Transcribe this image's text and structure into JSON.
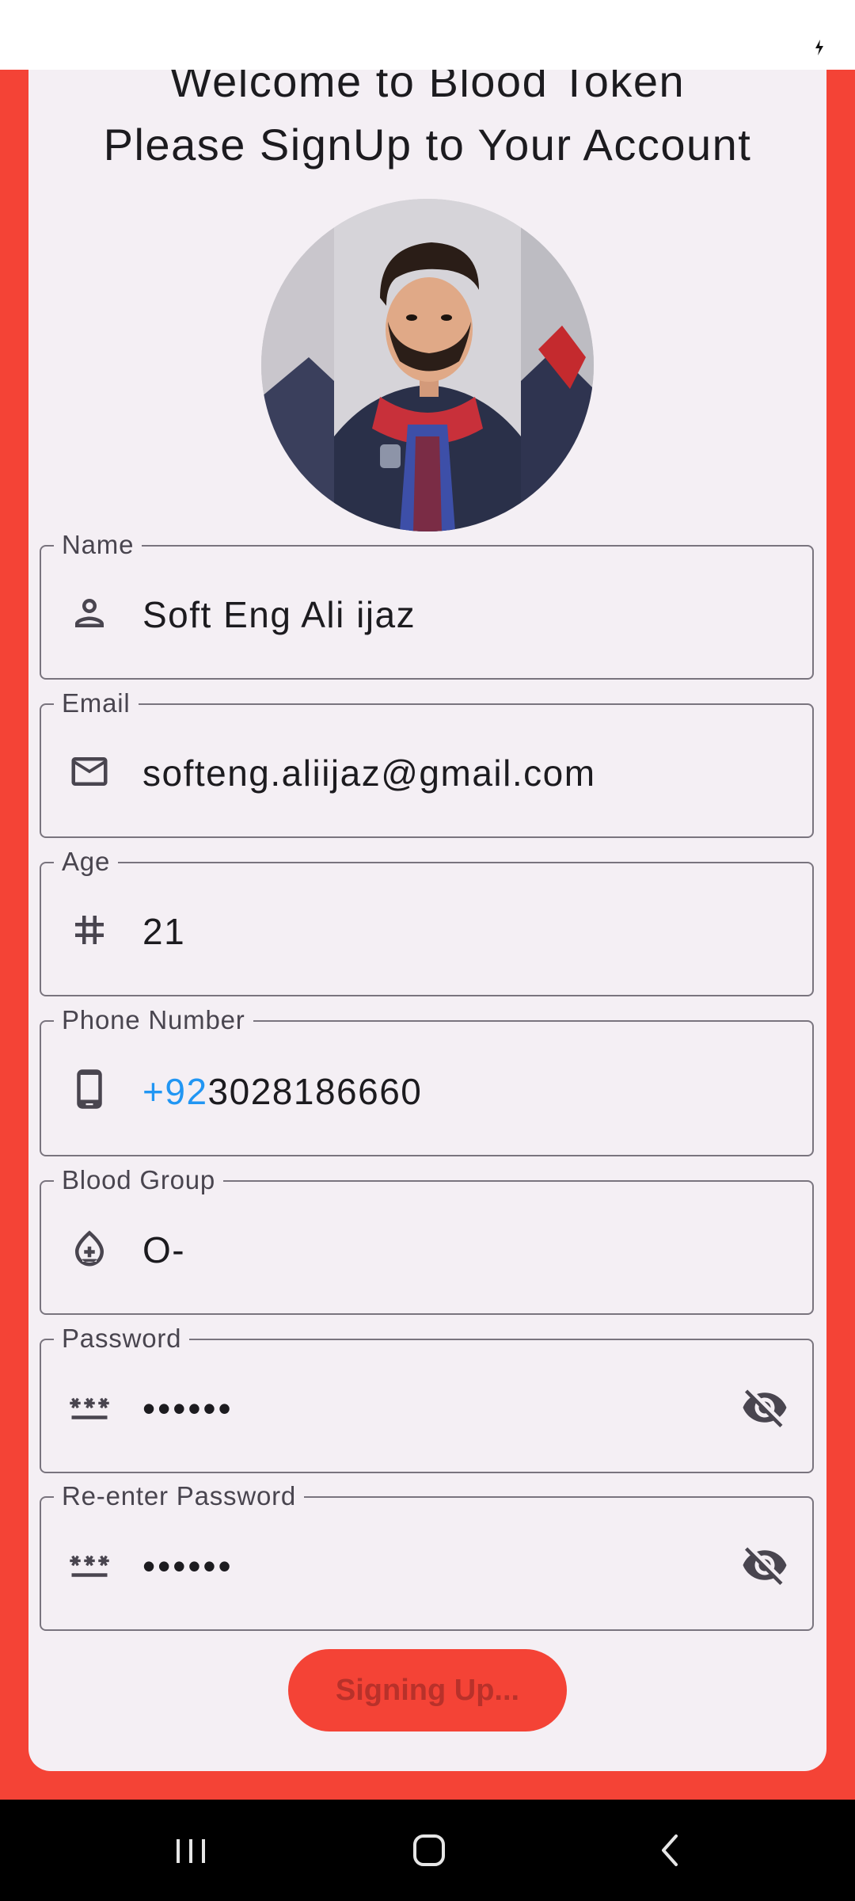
{
  "welcome": {
    "line1": "Welcome to Blood Token",
    "line2": "Please SignUp to Your Account"
  },
  "form": {
    "name": {
      "label": "Name",
      "value": "Soft Eng Ali ijaz",
      "icon": "person-icon"
    },
    "email": {
      "label": "Email",
      "value": "softeng.aliijaz@gmail.com",
      "icon": "mail-icon"
    },
    "age": {
      "label": "Age",
      "value": "21",
      "icon": "hash-icon"
    },
    "phone": {
      "label": "Phone Number",
      "country_code": "+92",
      "number": "3028186660",
      "icon": "phone-icon"
    },
    "blood_group": {
      "label": "Blood Group",
      "value": "O-",
      "icon": "blood-drop-icon"
    },
    "password": {
      "label": "Password",
      "value": "••••••",
      "icon": "password-icon",
      "toggle_icon": "visibility-off-icon"
    },
    "reenter_password": {
      "label": "Re-enter Password",
      "value": "••••••",
      "icon": "password-icon",
      "toggle_icon": "visibility-off-icon"
    }
  },
  "button": {
    "label": "Signing Up..."
  },
  "colors": {
    "primary": "#F44336",
    "surface": "#F4EFF4",
    "country_code": "#2196F3",
    "outline": "#79747E"
  },
  "nav": {
    "icons": [
      "recents-icon",
      "home-icon",
      "back-icon"
    ]
  }
}
